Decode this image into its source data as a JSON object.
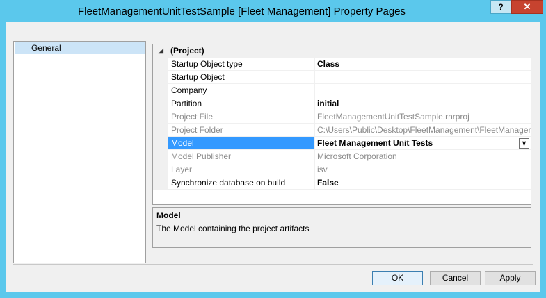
{
  "window": {
    "title": "FleetManagementUnitTestSample [Fleet Management] Property Pages",
    "help_label": "?",
    "close_label": "✕"
  },
  "nav": {
    "items": [
      {
        "label": "General",
        "selected": true
      }
    ]
  },
  "grid": {
    "category": {
      "glyph": "◢",
      "label": "(Project)"
    },
    "rows": [
      {
        "name": "Startup Object type",
        "value": "Class",
        "readonly": false,
        "bold": true
      },
      {
        "name": "Startup Object",
        "value": "",
        "readonly": false,
        "bold": false
      },
      {
        "name": "Company",
        "value": "",
        "readonly": false,
        "bold": false
      },
      {
        "name": "Partition",
        "value": "initial",
        "readonly": false,
        "bold": true
      },
      {
        "name": "Project File",
        "value": "FleetManagementUnitTestSample.rnrproj",
        "readonly": true,
        "bold": false
      },
      {
        "name": "Project Folder",
        "value": "C:\\Users\\Public\\Desktop\\FleetManagement\\FleetManager",
        "readonly": true,
        "bold": false
      },
      {
        "name": "Model",
        "value_before_caret": "Fleet M",
        "value_after_caret": "anagement Unit Tests",
        "readonly": false,
        "bold": true,
        "selected": true,
        "dropdown_icon": "chevron-down"
      },
      {
        "name": "Model Publisher",
        "value": "Microsoft Corporation",
        "readonly": true,
        "bold": false
      },
      {
        "name": "Layer",
        "value": "isv",
        "readonly": true,
        "bold": false
      },
      {
        "name": "Synchronize database on build",
        "value": "False",
        "readonly": false,
        "bold": true
      }
    ]
  },
  "description": {
    "title": "Model",
    "text": "The Model containing the project artifacts"
  },
  "buttons": {
    "ok": "OK",
    "cancel": "Cancel",
    "apply": "Apply"
  }
}
